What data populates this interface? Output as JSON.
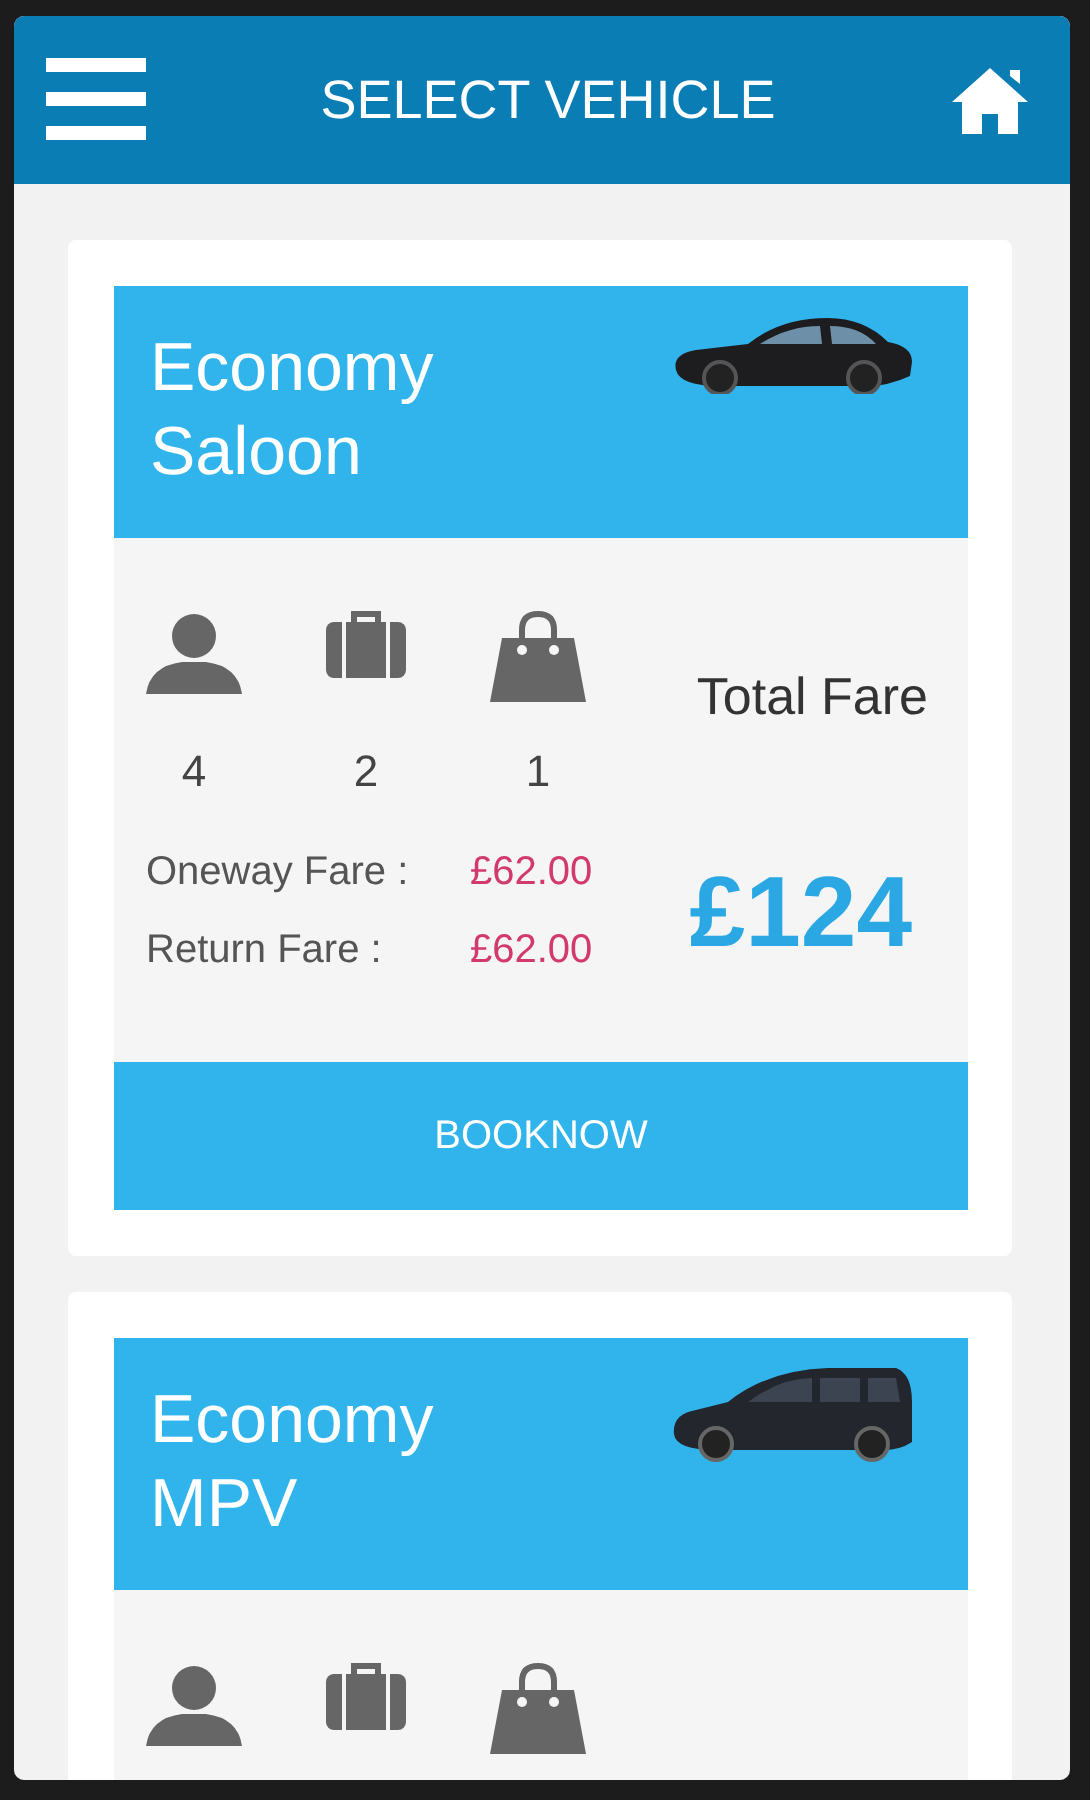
{
  "header": {
    "title": "SELECT VEHICLE"
  },
  "vehicles": [
    {
      "name": "Economy Saloon",
      "kind": "saloon",
      "passengers": "4",
      "suitcases": "2",
      "bags": "1",
      "fares": [
        {
          "label": "Oneway Fare :",
          "value": "£62.00"
        },
        {
          "label": "Return Fare :",
          "value": "£62.00"
        }
      ],
      "total_label": "Total Fare",
      "total": "£124",
      "button": "BOOKNOW"
    },
    {
      "name": "Economy MPV",
      "kind": "mpv"
    }
  ]
}
